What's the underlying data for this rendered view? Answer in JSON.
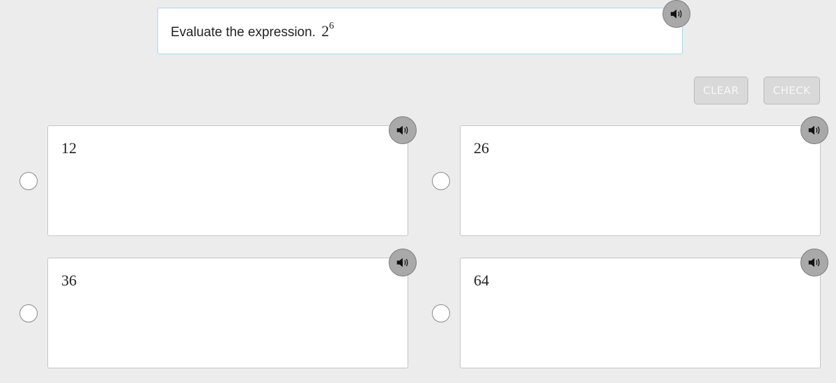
{
  "question": {
    "prefix": "Evaluate the expression.",
    "base": "2",
    "exponent": "6",
    "audio_icon": "speaker-icon"
  },
  "toolbar": {
    "clear_label": "CLEAR",
    "check_label": "CHECK"
  },
  "choices": [
    {
      "text": "12",
      "audio_icon": "speaker-icon",
      "selected": false
    },
    {
      "text": "26",
      "audio_icon": "speaker-icon",
      "selected": false
    },
    {
      "text": "36",
      "audio_icon": "speaker-icon",
      "selected": false
    },
    {
      "text": "64",
      "audio_icon": "speaker-icon",
      "selected": false
    }
  ],
  "colors": {
    "background": "#ececec",
    "question_border": "#a9d6e0",
    "audio_button": "#a9a9a9",
    "disabled_button": "#d9d9d9"
  }
}
